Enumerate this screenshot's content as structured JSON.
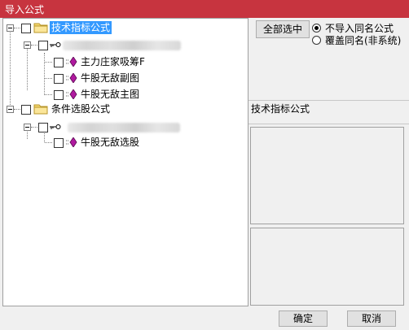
{
  "window": {
    "title": "导入公式"
  },
  "tree": {
    "nodes": [
      {
        "label": "技术指标公式",
        "type": "folder",
        "selected": true
      },
      {
        "label": "",
        "type": "key",
        "redacted": true
      },
      {
        "label": "主力庄家吸筹F",
        "type": "formula"
      },
      {
        "label": "牛股无敌副图",
        "type": "formula"
      },
      {
        "label": "牛股无敌主图",
        "type": "formula"
      },
      {
        "label": "条件选股公式",
        "type": "folder"
      },
      {
        "label": "",
        "type": "key",
        "redacted": true
      },
      {
        "label": "牛股无敌选股",
        "type": "formula"
      }
    ]
  },
  "right_panel": {
    "select_all_label": "全部选中",
    "radio_options": [
      {
        "label": "不导入同名公式",
        "checked": true
      },
      {
        "label": "覆盖同名(非系统)",
        "checked": false
      }
    ],
    "section_label": "技术指标公式"
  },
  "buttons": {
    "ok_label": "确定",
    "cancel_label": "取消"
  },
  "colors": {
    "titlebar": "#c7343f",
    "selection": "#3399ff",
    "formula_icon": "#b01a9f",
    "folder_icon": "#f5d76e"
  }
}
